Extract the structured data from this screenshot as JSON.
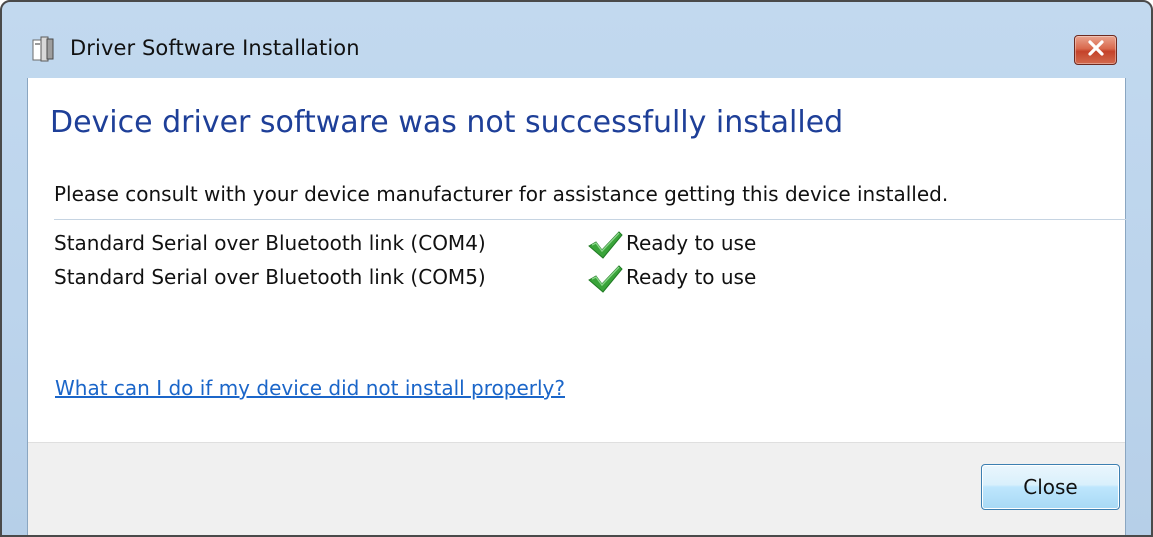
{
  "window": {
    "title": "Driver Software Installation",
    "title_icon": "device-installer-icon",
    "close_icon": "close-x-icon",
    "close_button_color": "#c4432a"
  },
  "main": {
    "heading": "Device driver software was not successfully installed",
    "heading_color": "#1e3f98",
    "instruction": "Please consult with your device manufacturer for assistance getting this device installed.",
    "devices": [
      {
        "name": "Standard Serial over Bluetooth link (COM4)",
        "status": "Ready to use",
        "status_icon": "green-check-icon"
      },
      {
        "name": "Standard Serial over Bluetooth link (COM5)",
        "status": "Ready to use",
        "status_icon": "green-check-icon"
      }
    ],
    "help_link": "What can I do if my device did not install properly?",
    "link_color": "#1b66c9"
  },
  "footer": {
    "close_label": "Close"
  }
}
